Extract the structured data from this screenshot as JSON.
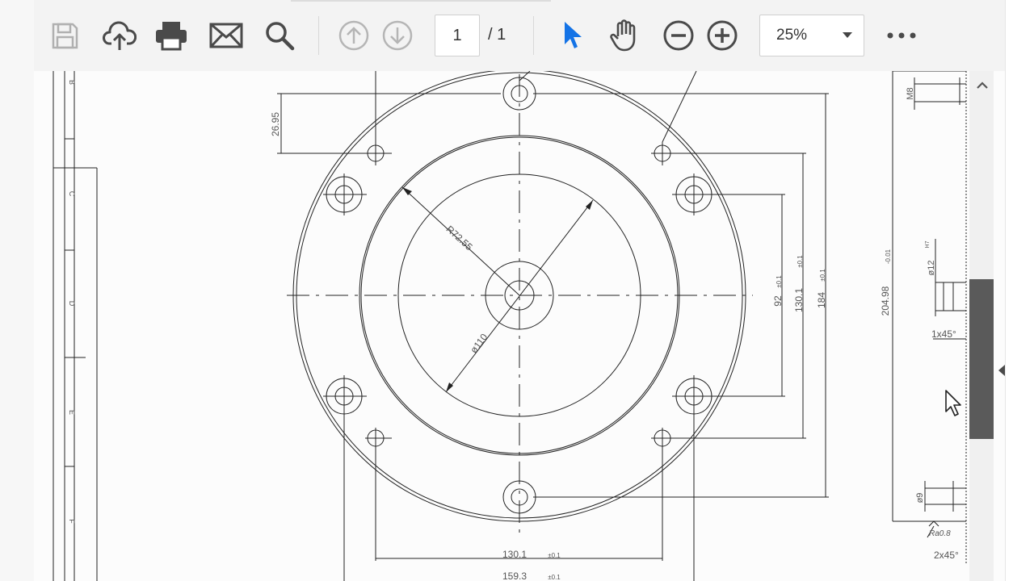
{
  "toolbar": {
    "page_current": "1",
    "page_total": "/ 1",
    "zoom_value": "25%"
  },
  "icons": [
    "save-icon",
    "cloud-upload-icon",
    "print-icon",
    "email-icon",
    "search-icon",
    "page-up-icon",
    "page-down-icon",
    "select-arrow-icon",
    "hand-tool-icon",
    "zoom-out-icon",
    "zoom-in-icon",
    "more-icon",
    "cursor-icon"
  ],
  "colors": {
    "select_tool": "#1473e6",
    "line": "#222222",
    "toolbar_bg": "#f3f3f3",
    "icon": "#4a4a4a"
  },
  "drawing": {
    "dim_top_left": "26.95",
    "radius_label": "R72.55",
    "dia_label": "ø110",
    "dim_92": "92",
    "dim_92_tol": "±0.1",
    "dim_130_v": "130.1",
    "dim_130_v_tol": "±0.1",
    "dim_184": "184",
    "dim_184_tol": "±0.1",
    "dim_130_h": "130.1",
    "dim_130_h_tol": "±0.1",
    "dim_159": "159.3",
    "dim_159_tol": "±0.1",
    "side_m8": "M8",
    "side_204": "204.98",
    "side_204_tol": "-0.01",
    "side_d12": "ø12",
    "side_d12_tol": "H7",
    "side_chamfer1": "1x45°",
    "side_d9": "ø9",
    "side_ra": "Ra0.8",
    "side_chamfer2": "2x45°",
    "frame_labels": [
      "B",
      "C",
      "D",
      "E",
      "F"
    ]
  }
}
